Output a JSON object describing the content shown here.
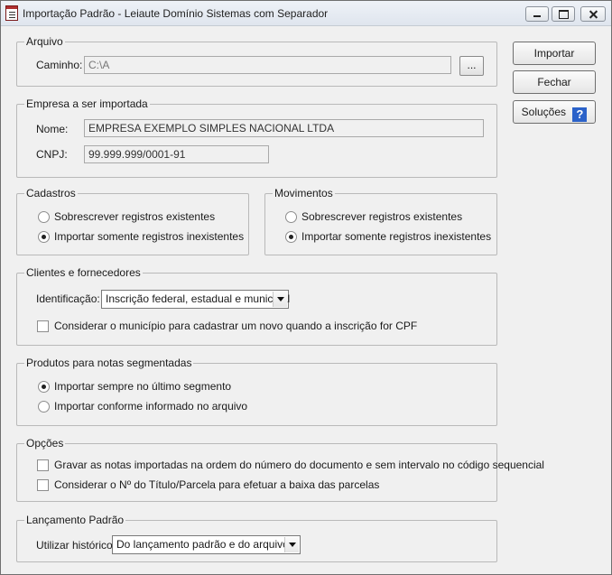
{
  "window": {
    "title": "Importação Padrão - Leiaute Domínio Sistemas com Separador",
    "icon": "document-icon"
  },
  "arquivo": {
    "legend": "Arquivo",
    "caminho_label": "Caminho:",
    "caminho_value": "C:\\A",
    "browse_label": "..."
  },
  "empresa": {
    "legend": "Empresa a ser importada",
    "nome_label": "Nome:",
    "nome_value": "EMPRESA EXEMPLO SIMPLES NACIONAL LTDA",
    "cnpj_label": "CNPJ:",
    "cnpj_value": "99.999.999/0001-91"
  },
  "cadastros": {
    "legend": "Cadastros",
    "options": [
      "Sobrescrever registros existentes",
      "Importar somente registros inexistentes"
    ],
    "selected": 1
  },
  "movimentos": {
    "legend": "Movimentos",
    "options": [
      "Sobrescrever registros existentes",
      "Importar somente registros inexistentes"
    ],
    "selected": 1
  },
  "clientes": {
    "legend": "Clientes e fornecedores",
    "identificacao_label": "Identificação:",
    "identificacao_value": "Inscrição federal, estadual e municipal",
    "check_label": "Considerar o município para cadastrar um novo quando a inscrição for CPF",
    "checked": false
  },
  "produtos": {
    "legend": "Produtos para notas segmentadas",
    "options": [
      "Importar sempre no último segmento",
      "Importar conforme informado no arquivo"
    ],
    "selected": 0
  },
  "opcoes": {
    "legend": "Opções",
    "checks": [
      "Gravar as notas importadas na ordem do número do documento e sem intervalo no código sequencial",
      "Considerar o Nº do Título/Parcela para efetuar a baixa das parcelas"
    ]
  },
  "lancamento": {
    "legend": "Lançamento Padrão",
    "historico_label": "Utilizar histórico:",
    "historico_value": "Do lançamento padrão e do arquivo"
  },
  "buttons": {
    "importar": "Importar",
    "fechar": "Fechar",
    "solucoes": "Soluções",
    "help_glyph": "?"
  }
}
